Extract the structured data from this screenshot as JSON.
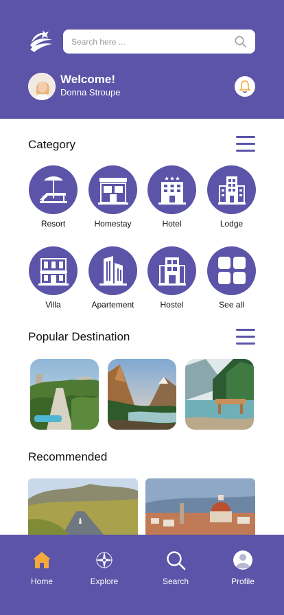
{
  "header": {
    "search_placeholder": "Search here ...",
    "welcome": "Welcome!",
    "user_name": "Donna Stroupe"
  },
  "category": {
    "title": "Category",
    "items": [
      {
        "label": "Resort",
        "icon": "resort-icon"
      },
      {
        "label": "Homestay",
        "icon": "homestay-icon"
      },
      {
        "label": "Hotel",
        "icon": "hotel-icon"
      },
      {
        "label": "Lodge",
        "icon": "lodge-icon"
      },
      {
        "label": "Villa",
        "icon": "villa-icon"
      },
      {
        "label": "Apartement",
        "icon": "apartment-icon"
      },
      {
        "label": "Hostel",
        "icon": "hostel-icon"
      },
      {
        "label": "See all",
        "icon": "grid-icon"
      }
    ]
  },
  "popular": {
    "title": "Popular Destination"
  },
  "recommended": {
    "title": "Recommended"
  },
  "nav": {
    "items": [
      {
        "label": "Home",
        "icon": "home-icon"
      },
      {
        "label": "Explore",
        "icon": "compass-icon"
      },
      {
        "label": "Search",
        "icon": "search-icon"
      },
      {
        "label": "Profile",
        "icon": "profile-icon"
      }
    ]
  },
  "colors": {
    "primary": "#5b54a8",
    "accent": "#f4a93a",
    "background": "#ffffff"
  }
}
